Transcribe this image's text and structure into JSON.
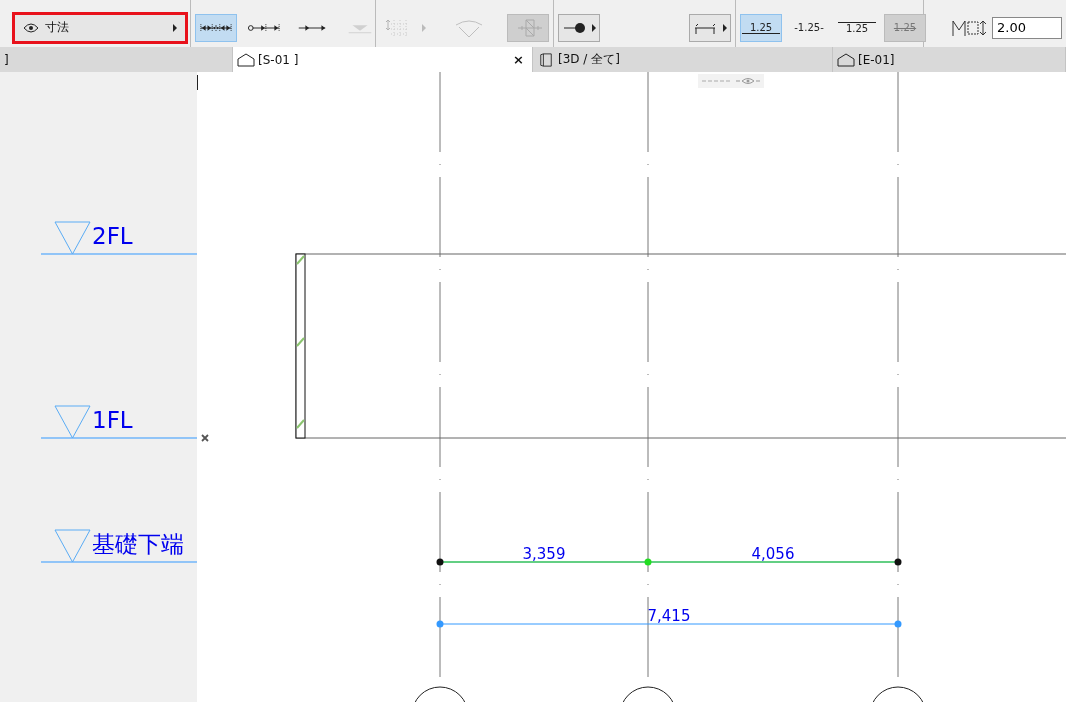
{
  "toolbar": {
    "view_dropdown": {
      "label": "寸法",
      "highlighted": true
    },
    "dimension_styles": [
      {
        "kind": "chain",
        "selected": true,
        "disabled": false
      },
      {
        "kind": "origin",
        "selected": false,
        "disabled": false
      },
      {
        "kind": "arrows",
        "selected": false,
        "disabled": false
      },
      {
        "kind": "level",
        "selected": false,
        "disabled": true
      }
    ],
    "grid_tools": [
      {
        "kind": "grid",
        "disabled": true
      },
      {
        "kind": "arc",
        "disabled": true
      },
      {
        "kind": "wall",
        "disabled": true
      }
    ],
    "marker_buttons": [
      {
        "kind": "dot"
      },
      {
        "kind": "tick"
      }
    ],
    "text_positions": [
      {
        "kind": "below",
        "label": "1.25",
        "selected": true,
        "disabled": false
      },
      {
        "kind": "inline",
        "label": "-1.25-",
        "selected": false,
        "disabled": false
      },
      {
        "kind": "above",
        "label": "1.25",
        "selected": false,
        "disabled": false
      },
      {
        "kind": "slash",
        "label": "1.25",
        "selected": false,
        "disabled": true
      }
    ],
    "height_field": {
      "value": "2.00"
    }
  },
  "tabs": [
    {
      "label": "]",
      "kind": "none",
      "selected": false
    },
    {
      "label": "[S-01 ]",
      "kind": "section",
      "selected": true,
      "close": "×"
    },
    {
      "label": "[3D / 全て]",
      "kind": "perspective",
      "selected": false
    },
    {
      "label": "[E-01]",
      "kind": "section",
      "selected": false
    }
  ],
  "drawing": {
    "levels": [
      {
        "name": "2FL"
      },
      {
        "name": "1FL"
      },
      {
        "name": "基礎下端"
      }
    ],
    "chain_dimensions": [
      "3,359",
      "4,056"
    ],
    "total_dimension": "7,415"
  }
}
